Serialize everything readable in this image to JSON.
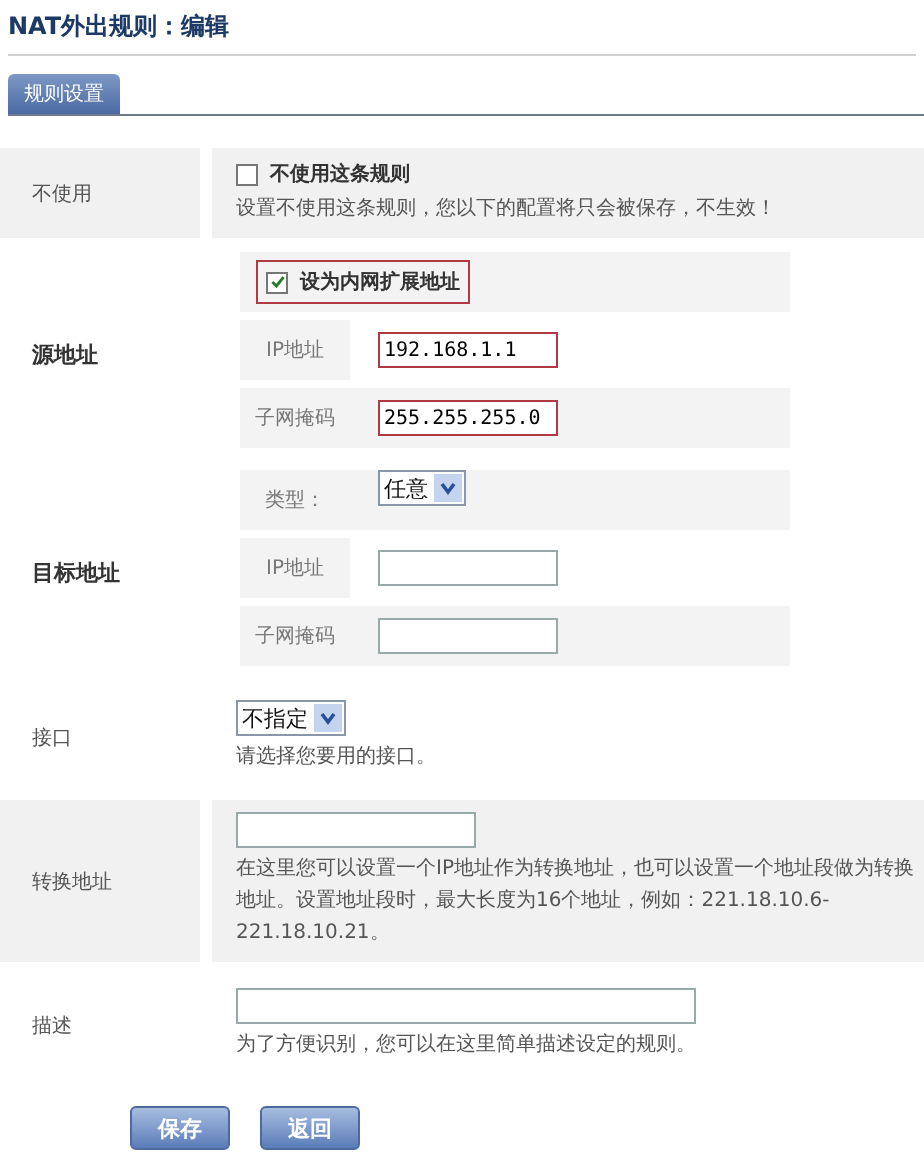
{
  "page_title": "NAT外出规则：编辑",
  "tabs": [
    {
      "label": "规则设置",
      "selected": true
    }
  ],
  "rows": [
    {
      "kind": "checkbox",
      "label": "不使用",
      "option": "不使用这条规则",
      "checked": false,
      "hint": "设置不使用这条规则，您以下的配置将只会被保存，不生效！",
      "shaded": true
    },
    {
      "kind": "group",
      "label": "源地址",
      "fields": [
        {
          "kind": "checkbox",
          "option": "设为内网扩展地址",
          "checked": true,
          "highlighted": true
        },
        {
          "kind": "input",
          "label": "IP地址",
          "value": "192.168.1.1",
          "highlighted": true
        },
        {
          "kind": "input",
          "label": "子网掩码",
          "value": "255.255.255.0",
          "highlighted": true
        }
      ]
    },
    {
      "kind": "group",
      "label": "目标地址",
      "fields": [
        {
          "kind": "select",
          "label": "类型：",
          "value": "任意"
        },
        {
          "kind": "input",
          "label": "IP地址",
          "highlighted": false
        },
        {
          "kind": "input",
          "label": "子网掩码",
          "highlighted": false
        }
      ]
    },
    {
      "kind": "select",
      "label": "接口",
      "value": "不指定",
      "hint": "请选择您要用的接口。",
      "shaded": false
    },
    {
      "kind": "input",
      "label": "转换地址",
      "hint": "在这里您可以设置一个IP地址作为转换地址，也可以设置一个地址段做为转换地址。设置地址段时，最大长度为16个地址，例如：221.18.10.6-221.18.10.21。",
      "shaded": true
    },
    {
      "kind": "long-input",
      "label": "描述",
      "hint": "为了方便识别，您可以在这里简单描述设定的规则。",
      "shaded": false
    }
  ],
  "buttons": [
    "保存",
    "返回"
  ]
}
